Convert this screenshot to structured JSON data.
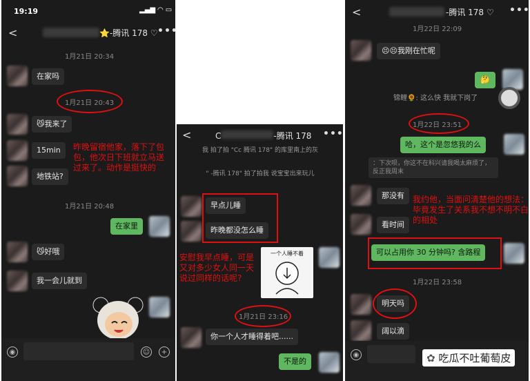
{
  "panel1": {
    "status_time": "19:19",
    "contact_suffix": "-腾讯 178",
    "timestamps": [
      "1月21日 20:34",
      "1月21日 20:43",
      "1月21日 20:48"
    ],
    "messages": [
      "在家吗",
      "我来了",
      "15min",
      "地铁站?",
      "在家里",
      "好哦",
      "我一会儿就到"
    ],
    "annotation": "昨晚留宿他家，落下了包包，他次日下班就立马送过来了。动作是挺快的"
  },
  "panel2": {
    "contact_prefix": "C",
    "contact_suffix": "-腾讯 178",
    "sys_line1": "我 拍了拍 \"Cc                   腾讯 178\" 的库里南上的灰",
    "sys_line2": "\"                -腾讯 178\" 拍了拍我 说宝宝出来玩儿",
    "messages": [
      "早点儿睡",
      "昨晚都没怎么睡",
      "你一个人才睡得着吧......",
      "不是的"
    ],
    "annotation": "安慰我早点睡，可是又对多少女人同一天说过同样的话呢?",
    "sticker_caption": "一个人睡不着",
    "timestamp": "1月21日 23:16"
  },
  "panel3": {
    "contact_suffix": "-腾讯 178",
    "timestamps": [
      "1月22日 22:09",
      "1月22日 23:51",
      "1月22日 23:58"
    ],
    "messages": [
      "我刚在忙呢",
      "哈，这个是忽悠我的么",
      "那没有",
      "看时间",
      "可以占用你 30 分钟吗? 含路程",
      "明天吗",
      "阔以滴"
    ],
    "system_note": "锦鲤🌻: 这么快 我就下岗了",
    "reply_quote": "：下次呗，你这不在科兴请我喝太麻烦了，反正我周末",
    "annotation": "我约他，当面问清楚他的想法：毕竟发生了关系我不想不明不白的相处",
    "watermark": "吃瓜不吐葡萄皮"
  }
}
